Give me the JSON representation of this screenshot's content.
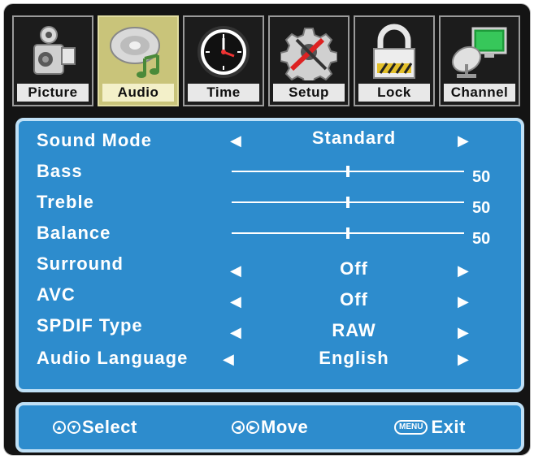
{
  "tabs": [
    {
      "label": "Picture",
      "icon": "camcorder-icon",
      "active": false
    },
    {
      "label": "Audio",
      "icon": "audio-disc-icon",
      "active": true
    },
    {
      "label": "Time",
      "icon": "clock-icon",
      "active": false
    },
    {
      "label": "Setup",
      "icon": "gear-tools-icon",
      "active": false
    },
    {
      "label": "Lock",
      "icon": "padlock-icon",
      "active": false
    },
    {
      "label": "Channel",
      "icon": "satellite-dish-icon",
      "active": false
    }
  ],
  "settings": {
    "sound_mode": {
      "label": "Sound Mode",
      "value": "Standard"
    },
    "bass": {
      "label": "Bass",
      "value": "50",
      "level": 0.5
    },
    "treble": {
      "label": "Treble",
      "value": "50",
      "level": 0.5
    },
    "balance": {
      "label": "Balance",
      "value": "50",
      "level": 0.5
    },
    "surround": {
      "label": "Surround",
      "value": "Off"
    },
    "avc": {
      "label": "AVC",
      "value": "Off"
    },
    "spdif_type": {
      "label": "SPDIF Type",
      "value": "RAW"
    },
    "audio_language": {
      "label": "Audio Language",
      "value": "English"
    }
  },
  "arrows": {
    "left": "◀",
    "right": "▶"
  },
  "footer": {
    "select": "Select",
    "move": "Move",
    "menu_key": "MENU",
    "exit": "Exit"
  },
  "colors": {
    "panel_blue": "#2d8ccd",
    "panel_border": "#bfe0f6",
    "active_tab": "#c9c47a",
    "frame": "#141414"
  }
}
